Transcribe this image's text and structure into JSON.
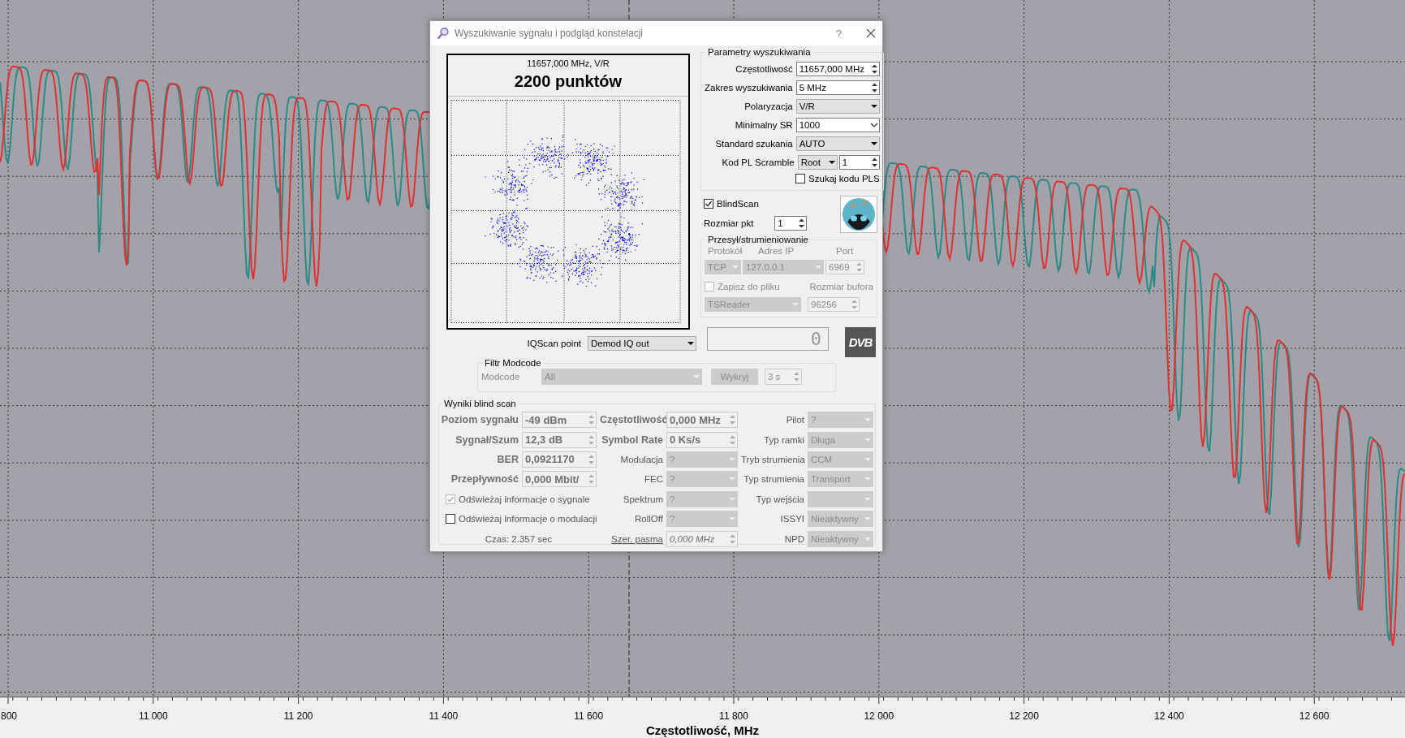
{
  "spectrum": {
    "x_axis": {
      "ticks": [
        "800",
        "11 000",
        "11 200",
        "11 400",
        "11 600",
        "11 800",
        "12 000",
        "12 200",
        "12 400",
        "12 600"
      ],
      "title": "Częstotliwość, MHz"
    }
  },
  "dialog": {
    "title": "Wyszukiwanie sygnału i podgląd konstelacji",
    "help": "?",
    "constellation": {
      "frequency_label": "11657,000 MHz, V/R",
      "points_label": "2200 punktów"
    },
    "search_params": {
      "title": "Parametry wyszukiwania",
      "fields": [
        {
          "kind": "spin",
          "label": "Częstotliwość",
          "value": "11657,000 MHz"
        },
        {
          "kind": "spin",
          "label": "Zakres wyszukiwania",
          "value": "5 MHz"
        },
        {
          "kind": "combo",
          "label": "Polaryzacja",
          "value": "V/R"
        },
        {
          "kind": "editcombo",
          "label": "Minimalny SR",
          "value": "1000"
        },
        {
          "kind": "combo",
          "label": "Standard szukania",
          "value": "AUTO"
        },
        {
          "kind": "combospin",
          "label": "Kod PL Scramble",
          "value": "Root",
          "value_2": "1"
        }
      ],
      "pls_search": {
        "label": "Szukaj kodu PLS",
        "checked": false
      }
    },
    "blindscan": {
      "label": "BlindScan",
      "checked": true
    },
    "point_size": {
      "label": "Rozmiar pkt",
      "value": "1"
    },
    "streaming": {
      "title": "Przesył/strumieniowanie",
      "disabled": true,
      "protocol_label": "Protokół",
      "ip_label": "Adres IP",
      "port_label": "Port",
      "protocol": "TCP",
      "ip": "127.0.0.1",
      "port": "6969",
      "save_to_file": {
        "label": "Zapisz do pliku",
        "checked": false
      },
      "buffer_label": "Rozmiar bufora",
      "target": "TSReader",
      "buffer": "96256"
    },
    "iqscan": {
      "label": "IQScan point",
      "value": "Demod IQ out"
    },
    "counter": "0",
    "dvb_logo": "DVB",
    "modcode_filter": {
      "title": "Filtr Modcode",
      "disabled": true,
      "label": "Modcode",
      "value": "All",
      "detect_button": "Wykryj",
      "interval": "3 s"
    },
    "results": {
      "title": "Wyniki blind scan",
      "left": [
        {
          "label": "Poziom sygnału",
          "value": "-49 dBm"
        },
        {
          "label": "Sygnał/Szum",
          "value": "12,3 dB"
        },
        {
          "label": "BER",
          "value": "0,0921170"
        },
        {
          "label": "Przepływność",
          "value": "0,000 Mbit/"
        }
      ],
      "refresh_options": [
        {
          "label": "Odświeżaj informacje o sygnale",
          "checked": true,
          "disabled": true
        },
        {
          "label": "Odświeżaj informacje o modulacji",
          "checked": false,
          "disabled": false
        }
      ],
      "elapsed_time": "Czas: 2.357 sec",
      "middle": [
        {
          "kind": "spin",
          "label": "Częstotliwość",
          "value": "0,000 MHz"
        },
        {
          "kind": "spin",
          "label": "Symbol Rate",
          "value": "0 Ks/s"
        },
        {
          "kind": "combo",
          "label": "Modulacja",
          "value": "?",
          "disabled": true
        },
        {
          "kind": "combo",
          "label": "FEC",
          "value": "?",
          "disabled": true
        },
        {
          "kind": "combo",
          "label": "Spektrum",
          "value": "?",
          "disabled": true
        },
        {
          "kind": "combo",
          "label": "RollOff",
          "value": "?",
          "disabled": true
        },
        {
          "kind": "linkspin",
          "label": "Szer. pasma",
          "value": "0,000 MHz"
        }
      ],
      "right": [
        {
          "label": "Pilot",
          "value": "?",
          "disabled": true
        },
        {
          "label": "Typ ramki",
          "value": "Długa",
          "disabled": true
        },
        {
          "label": "Tryb strumienia",
          "value": "CCM",
          "disabled": true
        },
        {
          "label": "Typ strumienia",
          "value": "Transport",
          "disabled": true
        },
        {
          "label": "Typ wejścia",
          "disabled": true
        },
        {
          "label": "ISSYI",
          "value": "Nieaktywny",
          "disabled": true
        },
        {
          "label": "NPD",
          "value": "Nieaktywny",
          "disabled": true
        }
      ]
    }
  }
}
